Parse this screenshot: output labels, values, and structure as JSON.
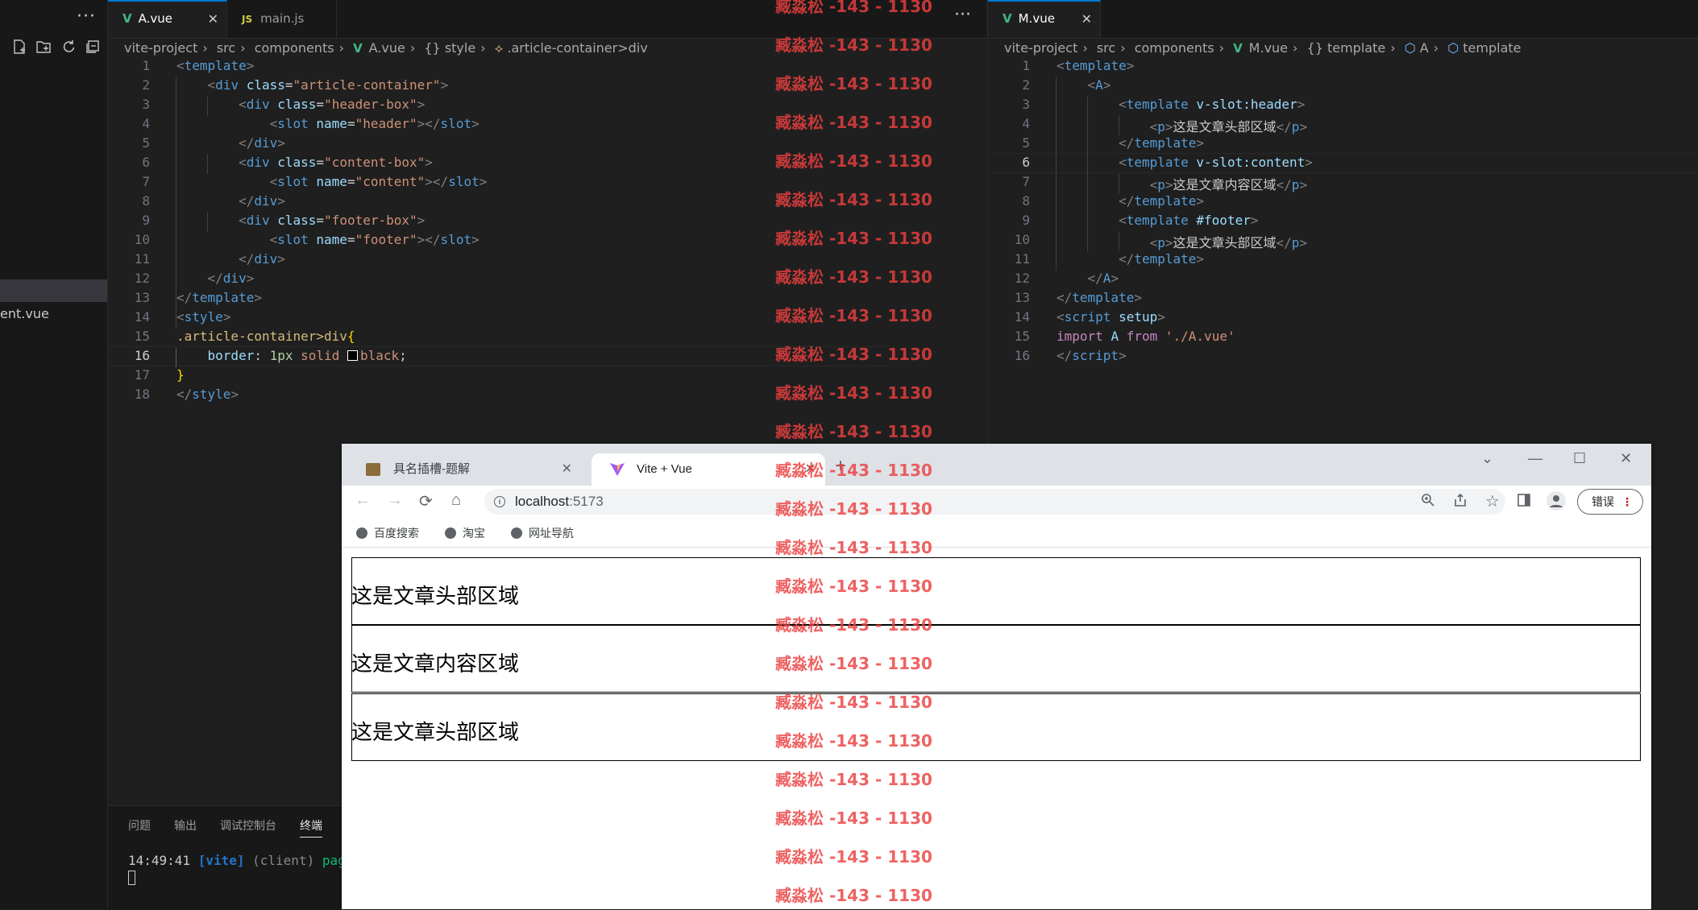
{
  "sidebar": {
    "more": "···",
    "icons": [
      "new-file-icon",
      "new-folder-icon",
      "refresh-icon",
      "collapse-icon"
    ],
    "partial_file": "ent.vue"
  },
  "editorA": {
    "tabs": [
      {
        "icon": "V",
        "label": "A.vue",
        "active": true,
        "close": "✕"
      },
      {
        "icon": "JS",
        "label": "main.js",
        "active": false
      }
    ],
    "more": "···",
    "breadcrumb": [
      "vite-project",
      "src",
      "components",
      "A.vue",
      "{} style",
      ".article-container>div"
    ],
    "lines": [
      "1",
      "2",
      "3",
      "4",
      "5",
      "6",
      "7",
      "8",
      "9",
      "10",
      "11",
      "12",
      "13",
      "14",
      "15",
      "16",
      "17",
      "18"
    ],
    "current_line": "16"
  },
  "editorM": {
    "tab": {
      "icon": "V",
      "label": "M.vue",
      "close": "✕"
    },
    "breadcrumb": [
      "vite-project",
      "src",
      "components",
      "M.vue",
      "{} template",
      "A",
      "template"
    ],
    "lines": [
      "1",
      "2",
      "3",
      "4",
      "5",
      "6",
      "7",
      "8",
      "9",
      "10",
      "11",
      "12",
      "13",
      "14",
      "15",
      "16"
    ],
    "current_line": "6"
  },
  "panel": {
    "tabs": [
      "问题",
      "输出",
      "调试控制台",
      "终端"
    ],
    "active_tab": "终端",
    "terminal": {
      "time": "14:49:41",
      "tag": "[vite]",
      "client": "(client)",
      "rest": "page"
    }
  },
  "browser": {
    "tabs": [
      {
        "label": "具名插槽-题解",
        "close": "✕"
      },
      {
        "label": "Vite + Vue",
        "close": "✕",
        "active": true
      }
    ],
    "new_tab": "+",
    "window": {
      "dropdown": "⌄",
      "minimize": "—",
      "maximize": "☐",
      "close": "✕"
    },
    "url_host": "localhost",
    "url_port": ":5173",
    "error_button": "错误",
    "bookmarks": [
      "百度搜索",
      "淘宝",
      "网址导航"
    ],
    "content": [
      "这是文章头部区域",
      "这是文章内容区域",
      "这是文章头部区域"
    ]
  },
  "watermark": {
    "text": "臧淼松 -143 - 1130",
    "count": 24
  }
}
